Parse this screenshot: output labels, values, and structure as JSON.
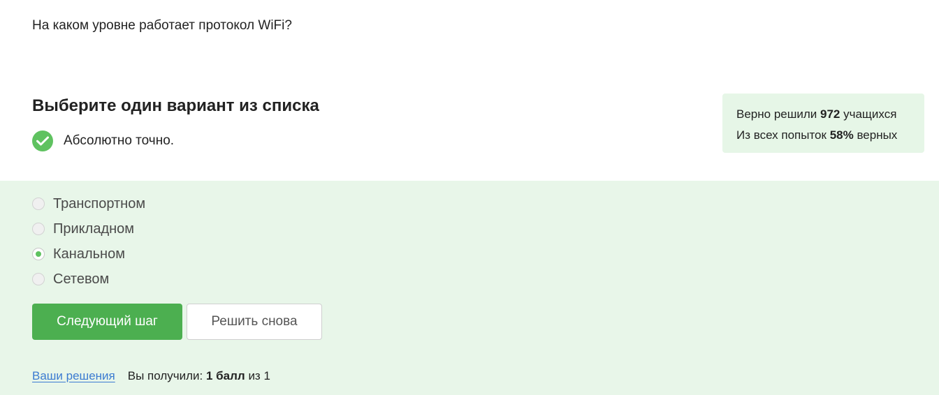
{
  "question": {
    "text": "На каком уровне работает протокол WiFi?"
  },
  "subtitle": "Выберите один вариант из списка",
  "feedback": {
    "icon": "check-icon",
    "color": "#5fc260",
    "text": "Абсолютно точно."
  },
  "stats": {
    "line1_prefix": "Верно решили",
    "solvers_count": "972",
    "line1_suffix": "учащихся",
    "line2_prefix": "Из всех попыток",
    "correct_percent": "58%",
    "line2_suffix": "верных"
  },
  "options": [
    {
      "label": "Транспортном",
      "selected": false
    },
    {
      "label": "Прикладном",
      "selected": false
    },
    {
      "label": "Канальном",
      "selected": true
    },
    {
      "label": "Сетевом",
      "selected": false
    }
  ],
  "buttons": {
    "next": "Следующий шаг",
    "retry": "Решить снова"
  },
  "footer": {
    "solutions_link": "Ваши решения",
    "score_prefix": "Вы получили:",
    "score_value": "1 балл",
    "score_suffix": "из 1"
  },
  "colors": {
    "accent_green": "#4caf50",
    "answer_bg": "#e8f6e9",
    "stats_bg": "#e6f6e7",
    "link": "#3b7bd1"
  }
}
